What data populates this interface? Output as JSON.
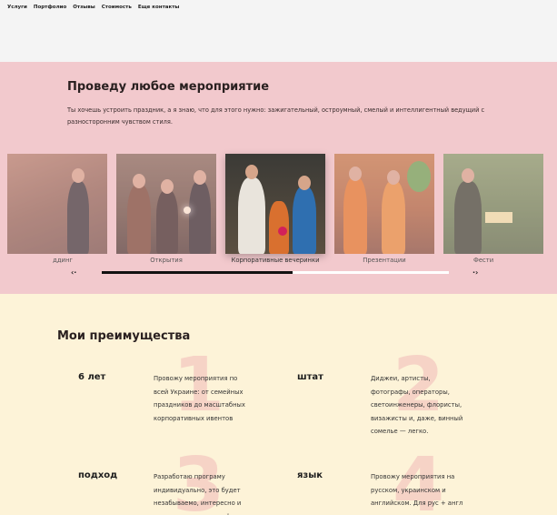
{
  "nav": {
    "items": [
      "Услуги",
      "Портфолио",
      "Отзывы",
      "Стоимость",
      "Еще контакты"
    ]
  },
  "events": {
    "title": "Проведу любое мероприятие",
    "intro": "Ты хочешь устроить праздник, а я знаю, что для этого нужно: зажигательный, остроумный, смелый и интеллигентный ведущий с разносторонним чувством стиля.",
    "slides": [
      {
        "label": "ддинг"
      },
      {
        "label": "Открытия"
      },
      {
        "label": "Корпоративные вечеринки"
      },
      {
        "label": "Презентации"
      },
      {
        "label": "Фести"
      }
    ],
    "progress": 0.55,
    "prev_icon": "‹·",
    "next_icon": "·›"
  },
  "advantages": {
    "title": "Мои преимущества",
    "items": [
      {
        "num": "1",
        "title": "6 лет",
        "text": "Провожу мероприятия по всей Украине: от семейных праздников до масштабных корпоративных ивентов"
      },
      {
        "num": "2",
        "title": "штат",
        "text": "Диджеи, артисты, фотографы, операторы, светоинженеры, флористы, визажисты и, даже, винный сомелье — легко."
      },
      {
        "num": "3",
        "title": "подход",
        "text": "Разработаю програму индивидуально, это будет незабываемо, интересно и весело для всех гостей"
      },
      {
        "num": "4",
        "title": "язык",
        "text": "Провожу мероприятия на русском, украинском и английском. Для рус + англ аудитории провожу"
      }
    ]
  },
  "colors": {
    "events_bg": "#f2c9cd",
    "advantages_bg": "#fdf3d8",
    "number_bg": "#f6d3c6"
  }
}
